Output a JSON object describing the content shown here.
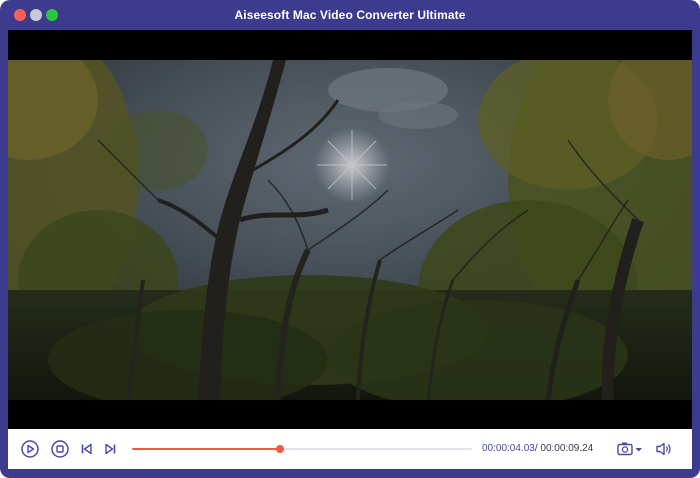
{
  "window": {
    "title": "Aiseesoft Mac Video Converter Ultimate"
  },
  "player": {
    "progress_fraction": 0.4364,
    "current_time": "00:00:04.03",
    "total_time": "00:00:09.24",
    "time_separator": "/ "
  },
  "icons": {
    "play": "play-icon",
    "stop": "stop-icon",
    "previous": "skip-previous-icon",
    "next": "skip-next-icon",
    "snapshot": "camera-icon",
    "volume": "volume-icon"
  },
  "colors": {
    "window_frame": "#3d3b8e",
    "accent": "#ef5b40",
    "control_icons": "#4a48a8"
  }
}
